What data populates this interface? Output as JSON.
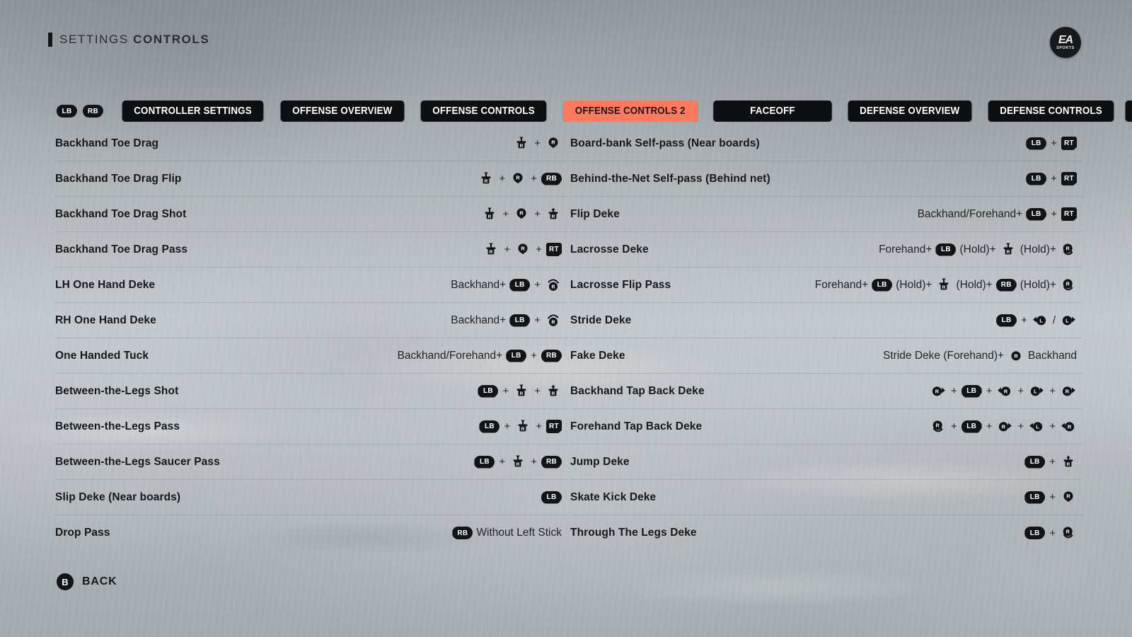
{
  "header": {
    "bar_icon": "accent-bar",
    "title_light": "SETTINGS",
    "title_bold": "CONTROLS"
  },
  "logo": {
    "mark": "EA",
    "sub": "SPORTS"
  },
  "tabbar": {
    "bumpers": [
      {
        "label": "LB",
        "name": "bumper-lb"
      },
      {
        "label": "RB",
        "name": "bumper-rb"
      }
    ],
    "tabs": [
      {
        "label": "CONTROLLER SETTINGS",
        "active": false
      },
      {
        "label": "OFFENSE OVERVIEW",
        "active": false
      },
      {
        "label": "OFFENSE CONTROLS",
        "active": false
      },
      {
        "label": "OFFENSE CONTROLS 2",
        "active": true
      },
      {
        "label": "FACEOFF",
        "active": false
      },
      {
        "label": "DEFENSE OVERVIEW",
        "active": false
      },
      {
        "label": "DEFENSE CONTROLS",
        "active": false
      },
      {
        "label": "",
        "active": false,
        "partial": true
      }
    ],
    "accent_color": "#ff7a5c",
    "tab_color": "#0d0f10"
  },
  "left_column": [
    {
      "label": "Backhand Toe Drag",
      "binding": [
        {
          "type": "stick",
          "stick": "R",
          "arrow": "down",
          "style": "flick"
        },
        {
          "type": "plus",
          "text": "+"
        },
        {
          "type": "stick",
          "stick": "R",
          "arrow": "down",
          "style": "hold"
        }
      ]
    },
    {
      "label": "Backhand Toe Drag Flip",
      "binding": [
        {
          "type": "stick",
          "stick": "R",
          "arrow": "down",
          "style": "flick"
        },
        {
          "type": "plus",
          "text": "+"
        },
        {
          "type": "stick",
          "stick": "R",
          "arrow": "down",
          "style": "hold"
        },
        {
          "type": "plus",
          "text": "+"
        },
        {
          "type": "shoulder",
          "label": "RB"
        }
      ]
    },
    {
      "label": "Backhand Toe Drag Shot",
      "binding": [
        {
          "type": "stick",
          "stick": "R",
          "arrow": "down",
          "style": "flick"
        },
        {
          "type": "plus",
          "text": "+"
        },
        {
          "type": "stick",
          "stick": "R",
          "arrow": "down",
          "style": "hold"
        },
        {
          "type": "plus",
          "text": "+"
        },
        {
          "type": "stick",
          "stick": "R",
          "arrow": "up",
          "style": "flick"
        }
      ]
    },
    {
      "label": "Backhand Toe Drag Pass",
      "binding": [
        {
          "type": "stick",
          "stick": "R",
          "arrow": "down",
          "style": "flick"
        },
        {
          "type": "plus",
          "text": "+"
        },
        {
          "type": "stick",
          "stick": "R",
          "arrow": "down",
          "style": "hold"
        },
        {
          "type": "plus",
          "text": "+"
        },
        {
          "type": "trigger",
          "label": "RT"
        }
      ]
    },
    {
      "label": "LH One Hand Deke",
      "binding": [
        {
          "type": "text",
          "text": "Backhand+"
        },
        {
          "type": "shoulder",
          "label": "LB"
        },
        {
          "type": "plus",
          "text": "+"
        },
        {
          "type": "stick",
          "stick": "R",
          "arrow": "rotate-left",
          "style": "rotate"
        }
      ]
    },
    {
      "label": "RH One Hand Deke",
      "binding": [
        {
          "type": "text",
          "text": "Backhand+"
        },
        {
          "type": "shoulder",
          "label": "LB"
        },
        {
          "type": "plus",
          "text": "+"
        },
        {
          "type": "stick",
          "stick": "R",
          "arrow": "rotate-right",
          "style": "rotate"
        }
      ]
    },
    {
      "label": "One Handed Tuck",
      "binding": [
        {
          "type": "text",
          "text": "Backhand/Forehand+"
        },
        {
          "type": "shoulder",
          "label": "LB"
        },
        {
          "type": "plus",
          "text": "+"
        },
        {
          "type": "shoulder",
          "label": "RB"
        }
      ]
    },
    {
      "label": "Between-the-Legs Shot",
      "binding": [
        {
          "type": "shoulder",
          "label": "LB"
        },
        {
          "type": "plus",
          "text": "+"
        },
        {
          "type": "stick",
          "stick": "R",
          "arrow": "down",
          "style": "flick"
        },
        {
          "type": "plus",
          "text": "+"
        },
        {
          "type": "stick",
          "stick": "R",
          "arrow": "up",
          "style": "flick"
        }
      ]
    },
    {
      "label": "Between-the-Legs Pass",
      "binding": [
        {
          "type": "shoulder",
          "label": "LB"
        },
        {
          "type": "plus",
          "text": "+"
        },
        {
          "type": "stick",
          "stick": "R",
          "arrow": "down",
          "style": "flick"
        },
        {
          "type": "plus",
          "text": "+"
        },
        {
          "type": "trigger",
          "label": "RT"
        }
      ]
    },
    {
      "label": "Between-the-Legs Saucer Pass",
      "binding": [
        {
          "type": "shoulder",
          "label": "LB"
        },
        {
          "type": "plus",
          "text": "+"
        },
        {
          "type": "stick",
          "stick": "R",
          "arrow": "down",
          "style": "flick"
        },
        {
          "type": "plus",
          "text": "+"
        },
        {
          "type": "shoulder",
          "label": "RB"
        }
      ]
    },
    {
      "label": "Slip Deke (Near boards)",
      "binding": [
        {
          "type": "shoulder",
          "label": "LB"
        }
      ]
    },
    {
      "label": "Drop Pass",
      "binding": [
        {
          "type": "shoulder",
          "label": "RB"
        },
        {
          "type": "text",
          "text": "Without Left Stick"
        }
      ]
    }
  ],
  "right_column": [
    {
      "label": "Board-bank Self-pass (Near boards)",
      "binding": [
        {
          "type": "shoulder",
          "label": "LB"
        },
        {
          "type": "plus",
          "text": "+"
        },
        {
          "type": "trigger",
          "label": "RT"
        }
      ]
    },
    {
      "label": "Behind-the-Net Self-pass (Behind net)",
      "binding": [
        {
          "type": "shoulder",
          "label": "LB"
        },
        {
          "type": "plus",
          "text": "+"
        },
        {
          "type": "trigger",
          "label": "RT"
        }
      ]
    },
    {
      "label": "Flip Deke",
      "binding": [
        {
          "type": "text",
          "text": "Backhand/Forehand+"
        },
        {
          "type": "shoulder",
          "label": "LB"
        },
        {
          "type": "plus",
          "text": "+"
        },
        {
          "type": "trigger",
          "label": "RT"
        }
      ]
    },
    {
      "label": "Lacrosse Deke",
      "binding": [
        {
          "type": "text",
          "text": "Forehand+"
        },
        {
          "type": "shoulder",
          "label": "LB"
        },
        {
          "type": "text",
          "text": "(Hold)+"
        },
        {
          "type": "stick",
          "stick": "R",
          "arrow": "down",
          "style": "flick"
        },
        {
          "type": "text",
          "text": "(Hold)+"
        },
        {
          "type": "stick",
          "stick": "R",
          "arrow": "swoop",
          "style": "swoop"
        }
      ]
    },
    {
      "label": "Lacrosse Flip Pass",
      "binding": [
        {
          "type": "text",
          "text": "Forehand+"
        },
        {
          "type": "shoulder",
          "label": "LB"
        },
        {
          "type": "text",
          "text": "(Hold)+"
        },
        {
          "type": "stick",
          "stick": "R",
          "arrow": "down",
          "style": "flick"
        },
        {
          "type": "text",
          "text": "(Hold)+"
        },
        {
          "type": "shoulder",
          "label": "RB"
        },
        {
          "type": "text",
          "text": "(Hold)+"
        },
        {
          "type": "stick",
          "stick": "R",
          "arrow": "swoop",
          "style": "swoop"
        }
      ]
    },
    {
      "label": "Stride Deke",
      "binding": [
        {
          "type": "shoulder",
          "label": "LB"
        },
        {
          "type": "plus",
          "text": "+"
        },
        {
          "type": "stick",
          "stick": "L",
          "arrow": "left",
          "style": "dir"
        },
        {
          "type": "slash",
          "text": "/"
        },
        {
          "type": "stick",
          "stick": "L",
          "arrow": "right",
          "style": "dir"
        }
      ]
    },
    {
      "label": "Fake Deke",
      "binding": [
        {
          "type": "text",
          "text": "Stride Deke (Forehand)+"
        },
        {
          "type": "stick",
          "stick": "R",
          "arrow": "none",
          "style": "plain"
        },
        {
          "type": "text",
          "text": "Backhand"
        }
      ]
    },
    {
      "label": "Backhand Tap Back Deke",
      "binding": [
        {
          "type": "stick",
          "stick": "R",
          "arrow": "right",
          "style": "dir"
        },
        {
          "type": "plus",
          "text": "+"
        },
        {
          "type": "shoulder",
          "label": "LB"
        },
        {
          "type": "plus",
          "text": "+"
        },
        {
          "type": "stick",
          "stick": "R",
          "arrow": "left",
          "style": "dir"
        },
        {
          "type": "plus",
          "text": "+"
        },
        {
          "type": "stick",
          "stick": "L",
          "arrow": "right",
          "style": "dir"
        },
        {
          "type": "plus",
          "text": "+"
        },
        {
          "type": "stick",
          "stick": "R",
          "arrow": "right",
          "style": "dir"
        }
      ]
    },
    {
      "label": "Forehand Tap Back Deke",
      "binding": [
        {
          "type": "stick",
          "stick": "R",
          "arrow": "swoop",
          "style": "swoop"
        },
        {
          "type": "plus",
          "text": "+"
        },
        {
          "type": "shoulder",
          "label": "LB"
        },
        {
          "type": "plus",
          "text": "+"
        },
        {
          "type": "stick",
          "stick": "R",
          "arrow": "right",
          "style": "dir"
        },
        {
          "type": "plus",
          "text": "+"
        },
        {
          "type": "stick",
          "stick": "L",
          "arrow": "left",
          "style": "dir"
        },
        {
          "type": "plus",
          "text": "+"
        },
        {
          "type": "stick",
          "stick": "R",
          "arrow": "left",
          "style": "dir"
        }
      ]
    },
    {
      "label": "Jump Deke",
      "binding": [
        {
          "type": "shoulder",
          "label": "LB"
        },
        {
          "type": "plus",
          "text": "+"
        },
        {
          "type": "stick",
          "stick": "R",
          "arrow": "up",
          "style": "flick"
        }
      ]
    },
    {
      "label": "Skate Kick Deke",
      "binding": [
        {
          "type": "shoulder",
          "label": "LB"
        },
        {
          "type": "plus",
          "text": "+"
        },
        {
          "type": "stick",
          "stick": "R",
          "arrow": "down",
          "style": "hold"
        }
      ]
    },
    {
      "label": "Through The Legs Deke",
      "binding": [
        {
          "type": "shoulder",
          "label": "LB"
        },
        {
          "type": "plus",
          "text": "+"
        },
        {
          "type": "stick",
          "stick": "R",
          "arrow": "swoop",
          "style": "swoop"
        }
      ]
    }
  ],
  "footer": {
    "button": "B",
    "label": "BACK"
  }
}
